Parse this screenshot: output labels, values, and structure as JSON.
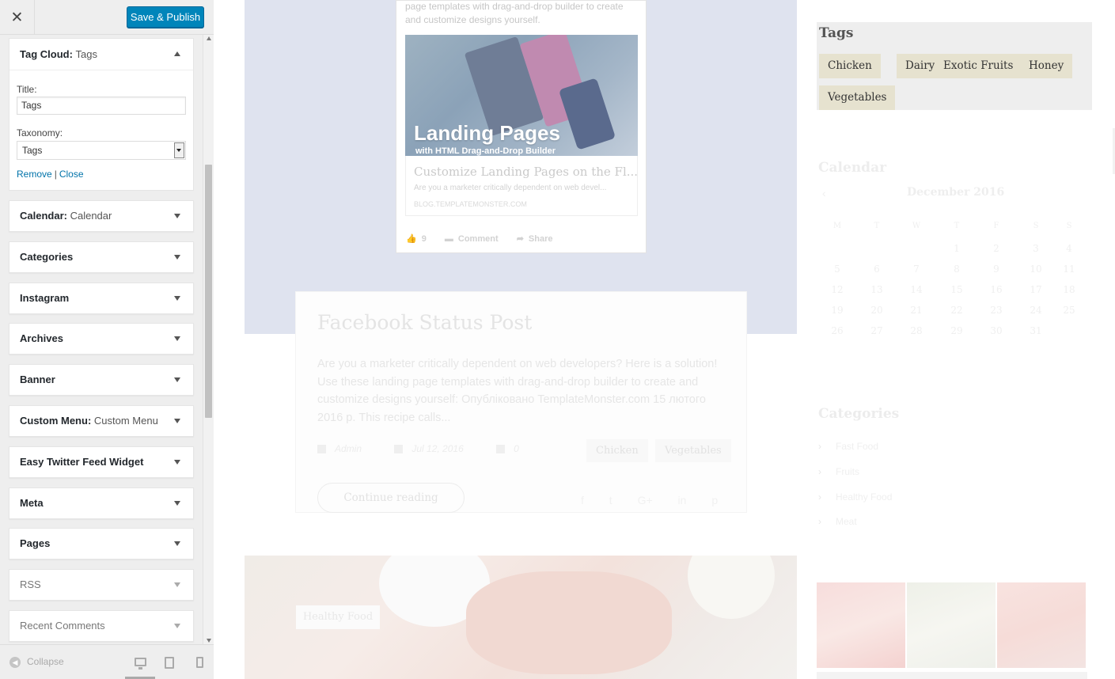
{
  "sidebar": {
    "close_icon": "close-icon",
    "publish_label": "Save & Publish",
    "tag_cloud": {
      "title": "Tag Cloud:",
      "subtitle": "Tags",
      "title_label": "Title:",
      "title_value": "Tags",
      "taxonomy_label": "Taxonomy:",
      "taxonomy_value": "Tags",
      "remove_label": "Remove",
      "separator": "|",
      "close_label": "Close"
    },
    "widgets": [
      {
        "name": "Calendar:",
        "sub": "Calendar"
      },
      {
        "name": "Categories",
        "sub": ""
      },
      {
        "name": "Instagram",
        "sub": ""
      },
      {
        "name": "Archives",
        "sub": ""
      },
      {
        "name": "Banner",
        "sub": ""
      },
      {
        "name": "Custom Menu:",
        "sub": "Custom Menu"
      },
      {
        "name": "Easy Twitter Feed Widget",
        "sub": ""
      },
      {
        "name": "Meta",
        "sub": ""
      },
      {
        "name": "Pages",
        "sub": ""
      },
      {
        "name": "RSS",
        "sub": ""
      },
      {
        "name": "Recent Comments",
        "sub": ""
      }
    ],
    "footer": {
      "collapse_label": "Collapse"
    },
    "accent_color": "#0085ba"
  },
  "preview": {
    "fb_card": {
      "text": "page templates with drag-and-drop builder to create and customize designs yourself.",
      "image_title": "Landing Pages",
      "image_subtitle": "with HTML Drag-and-Drop Builder",
      "link_title": "Customize Landing Pages on the Fl...",
      "link_desc": "Are you a marketer critically dependent on web devel...",
      "link_domain": "BLOG.TEMPLATEMONSTER.COM",
      "likes": "9",
      "comment_label": "Comment",
      "share_label": "Share"
    },
    "post": {
      "title": "Facebook Status Post",
      "excerpt": "Are you a marketer critically dependent on web developers? Here is a solution! Use these landing page templates with drag-and-drop builder to create and customize designs yourself: Опубліковано TemplateMonster.com 15 лютого 2016 р. This recipe calls...",
      "author": "Admin",
      "date": "Jul 12, 2016",
      "comments": "0",
      "tags": [
        "Chicken",
        "Vegetables"
      ],
      "continue_label": "Continue reading",
      "social": [
        "f",
        "t",
        "G+",
        "in",
        "p"
      ]
    },
    "bottom_badge": "Healthy Food",
    "tags_widget": {
      "title": "Tags",
      "tags": [
        "Chicken",
        "Dairy",
        "Exotic Fruits",
        "Honey",
        "Vegetables"
      ]
    },
    "calendar": {
      "title": "Calendar",
      "month": "December 2016",
      "prev": "‹",
      "headers": [
        "M",
        "T",
        "W",
        "T",
        "F",
        "S",
        "S"
      ],
      "weeks": [
        [
          "",
          "",
          "",
          "1",
          "2",
          "3",
          "4"
        ],
        [
          "5",
          "6",
          "7",
          "8",
          "9",
          "10",
          "11"
        ],
        [
          "12",
          "13",
          "14",
          "15",
          "16",
          "17",
          "18"
        ],
        [
          "19",
          "20",
          "21",
          "22",
          "23",
          "24",
          "25"
        ],
        [
          "26",
          "27",
          "28",
          "29",
          "30",
          "31",
          ""
        ]
      ]
    },
    "categories": {
      "title": "Categories",
      "items": [
        "Fast Food",
        "Fruits",
        "Healthy Food",
        "Meat"
      ]
    }
  }
}
